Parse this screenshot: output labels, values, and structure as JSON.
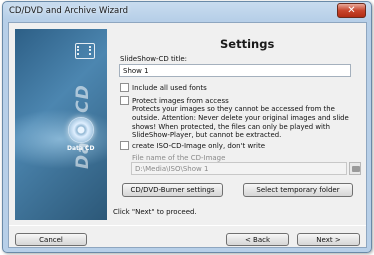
{
  "window": {
    "title": "CD/DVD and Archive Wizard",
    "close_glyph": "✕"
  },
  "banner": {
    "vertical_text": "Data CD",
    "disc_label": "Data CD"
  },
  "page": {
    "heading": "Settings"
  },
  "form": {
    "slideshow_title_label": "SlideShow-CD title:",
    "slideshow_title_value": "Show 1",
    "include_fonts_label": "Include all used fonts",
    "include_fonts_checked": false,
    "protect_label": "Protect images from access",
    "protect_checked": false,
    "protect_description": "Protects your images so they cannot be accessed from the outside. Attention: Never delete your original images and slide shows! When protected, the files can only be played with SlideShow-Player, but cannot be extracted.",
    "iso_only_label": "create ISO-CD-Image only, don't write",
    "iso_only_checked": false,
    "iso_file_label": "File name of the CD-Image",
    "iso_file_value": "D:\\Media\\ISO\\Show 1",
    "burner_settings_button": "CD/DVD-Burner settings",
    "temp_folder_button": "Select temporary folder",
    "hint": "Click \"Next\" to proceed."
  },
  "footer": {
    "cancel": "Cancel",
    "back": "< Back",
    "next": "Next >"
  },
  "colors": {
    "title_bar": "#b7cfe8",
    "close_button": "#c8452c",
    "banner": "#2d5f86"
  }
}
